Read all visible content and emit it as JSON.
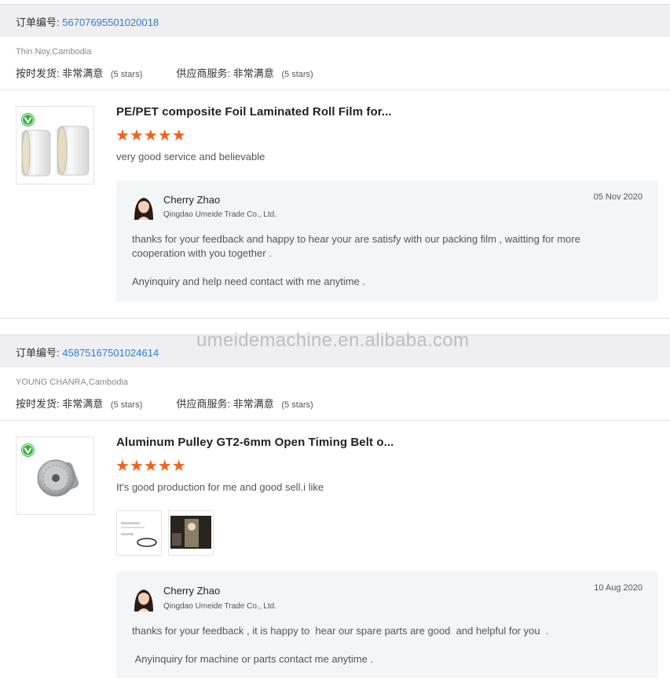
{
  "orders": [
    {
      "order_label": "订单编号:",
      "order_number": "56707695501020018",
      "buyer": "Thin Noy,Cambodia",
      "ontime_label": "按时发货:",
      "ontime_value": "非常满意",
      "ontime_stars": "(5 stars)",
      "service_label": "供应商服务:",
      "service_value": "非常满意",
      "service_stars": "(5 stars)",
      "product_title": "PE/PET composite Foil Laminated Roll Film for...",
      "rating": 5,
      "stars_display": "★★★★★",
      "comment": "very good service and believable",
      "reply": {
        "name": "Cherry Zhao",
        "company": "Qingdao Umeide Trade Co., Ltd.",
        "date": "05 Nov 2020",
        "text": "thanks for your feedback and happy to hear your are satisfy with our packing film , waitting for more cooperation with you together .\n\nAnyinquiry and help need contact with me anytime ."
      }
    },
    {
      "order_label": "订单编号:",
      "order_number": "45875167501024614",
      "buyer": "YOUNG CHANRA,Cambodia",
      "ontime_label": "按时发货:",
      "ontime_value": "非常满意",
      "ontime_stars": "(5 stars)",
      "service_label": "供应商服务:",
      "service_value": "非常满意",
      "service_stars": "(5 stars)",
      "product_title": "Aluminum Pulley GT2-6mm Open Timing Belt o...",
      "rating": 5,
      "stars_display": "★★★★★",
      "comment": "It's good production for me and good sell.i like",
      "reply": {
        "name": "Cherry Zhao",
        "company": "Qingdao Umeide Trade Co., Ltd.",
        "date": "10 Aug 2020",
        "text": "thanks for your feedback , it is happy to  hear our spare parts are good  and helpful for you  .\n\n Anyinquiry for machine or parts contact me anytime ."
      }
    }
  ],
  "watermark": "umeidemachine.en.alibaba.com",
  "colors": {
    "accent_link": "#2a7fd4",
    "star": "#f4611c",
    "header_bg": "#efeff1",
    "reply_bg": "#f4f5f7",
    "badge": "#3cb043"
  },
  "icons": [
    "verified-badge-icon",
    "star-icon"
  ]
}
